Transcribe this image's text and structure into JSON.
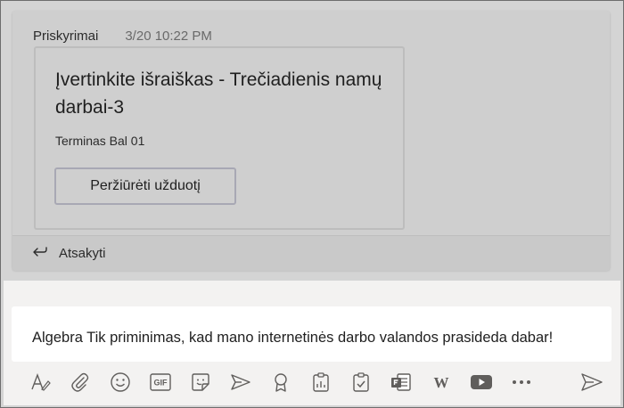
{
  "post": {
    "channel_label": "Priskyrimai",
    "timestamp": "3/20 10:22 PM",
    "assignment": {
      "title": "Įvertinkite išraiškas - Trečiadienis namų darbai-3",
      "due": "Terminas Bal 01",
      "view_button": "Peržiūrėti užduotį"
    },
    "reply_label": "Atsakyti"
  },
  "compose": {
    "text": "Algebra Tik priminimas, kad mano internetinės darbo valandos prasideda dabar!"
  },
  "toolbar": {
    "icons": [
      "format-icon",
      "attach-icon",
      "emoji-icon",
      "gif-icon",
      "sticker-icon",
      "meet-now-icon",
      "praise-icon",
      "assignments-icon",
      "approvals-icon",
      "forms-icon",
      "wikipedia-icon",
      "youtube-icon",
      "more-options-icon",
      "send-icon"
    ],
    "gif_label": "GIF",
    "wiki_label": "W"
  },
  "colors": {
    "overlay_gray": "#cfcfcf",
    "compose_bg": "#f3f2f1",
    "icon_gray": "#605e5c",
    "button_border": "#a8a8b4"
  }
}
